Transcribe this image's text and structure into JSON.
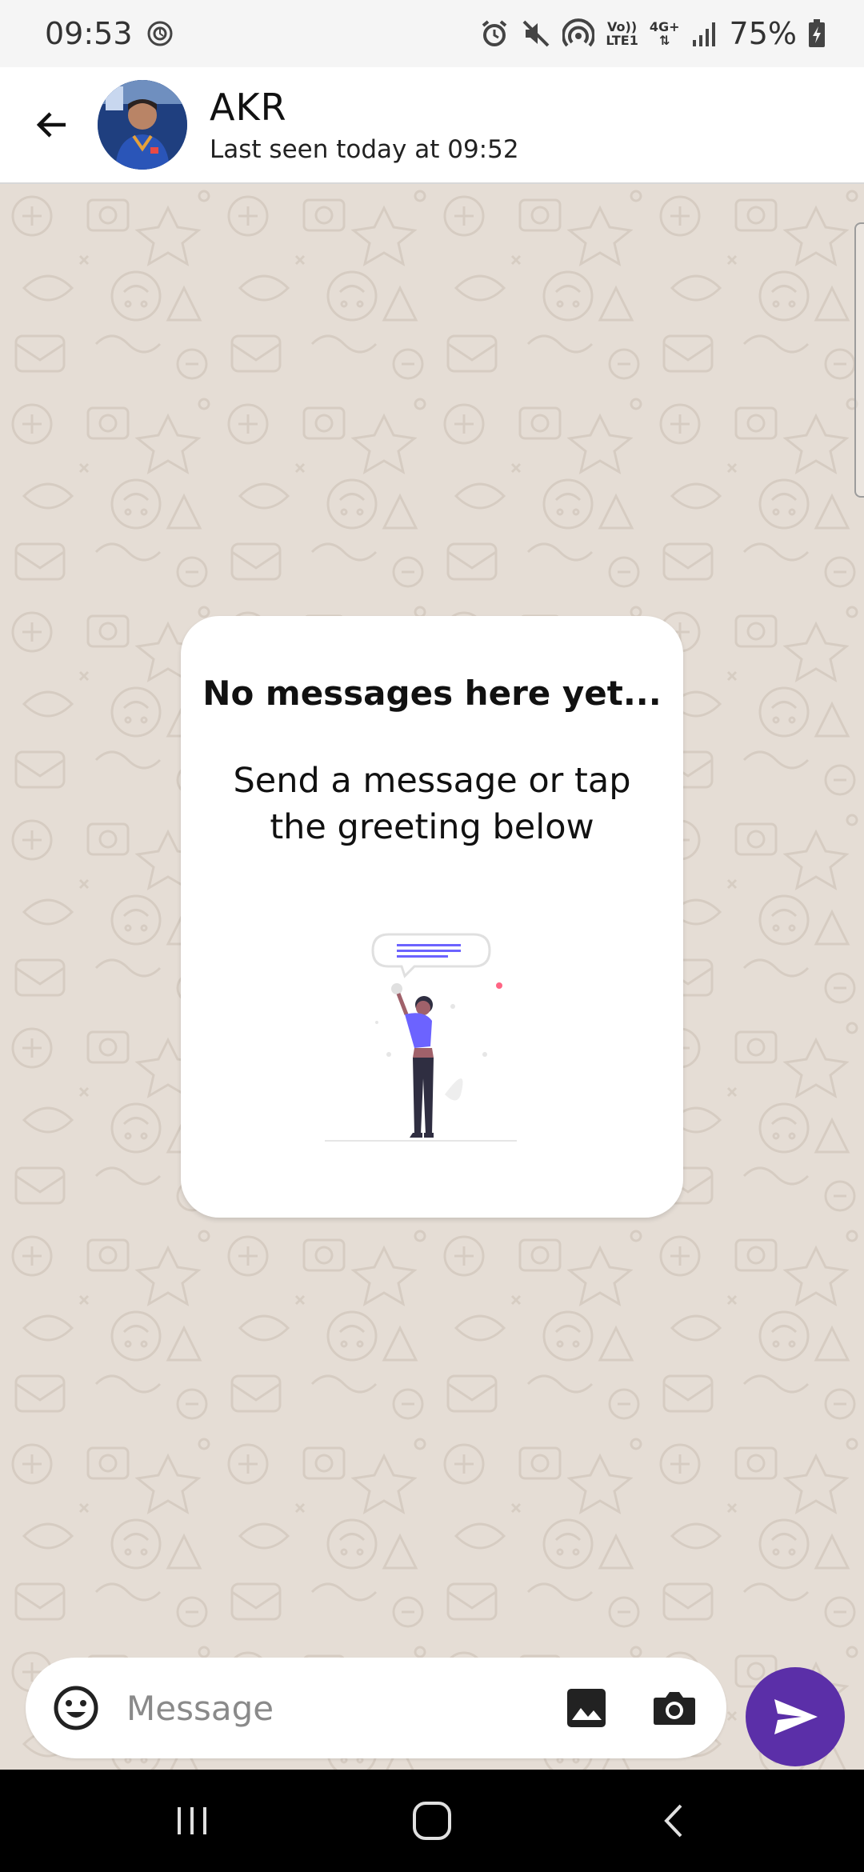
{
  "status_bar": {
    "time": "09:53",
    "network_top": "Vo))",
    "network_bottom": "LTE1",
    "data_top": "4G+",
    "battery": "75%"
  },
  "header": {
    "contact_name": "AKR",
    "last_seen": "Last seen today at 09:52"
  },
  "empty_state": {
    "title": "No messages here yet...",
    "subtitle": "Send a message or tap the greeting below"
  },
  "composer": {
    "placeholder": "Message"
  },
  "colors": {
    "accent": "#5b2fa8",
    "illustration_purple": "#6c63ff",
    "wallpaper": "#e5ddd5"
  },
  "icons": {
    "emoji": "emoji-icon",
    "gallery": "image-icon",
    "camera": "camera-icon",
    "send": "send-icon",
    "back": "arrow-left-icon"
  }
}
